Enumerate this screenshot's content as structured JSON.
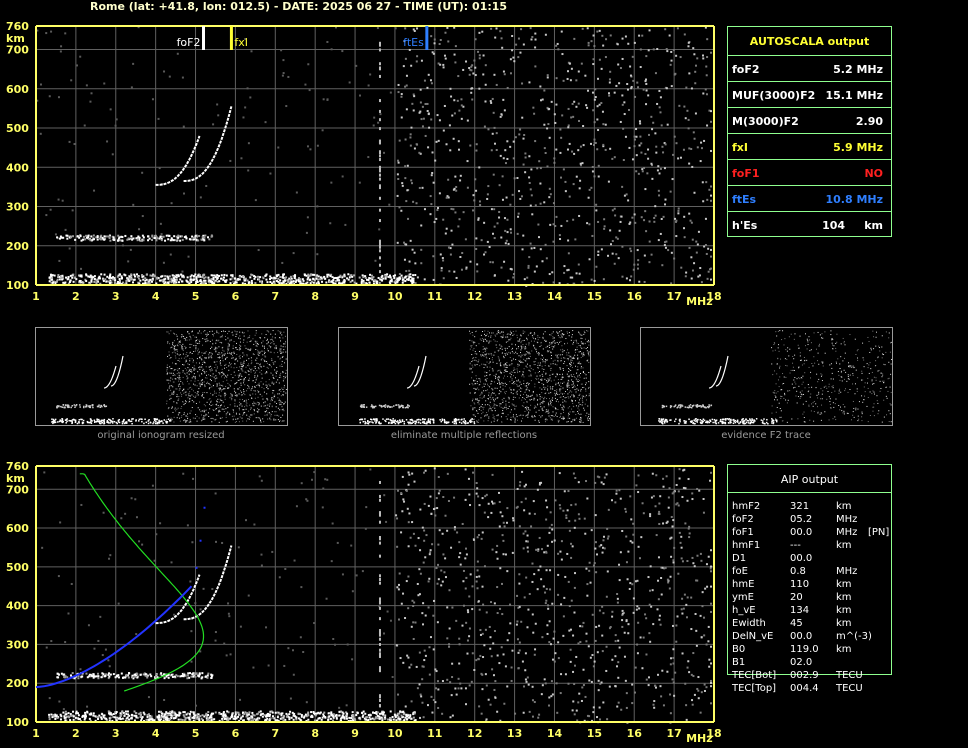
{
  "header": {
    "title": "Rome (lat: +41.8, lon: 012.5) - DATE: 2025 06 27 - TIME (UT): 01:15"
  },
  "top_chart": {
    "y_unit": "km",
    "x_unit": "MHz",
    "y_ticks": [
      "760",
      "700",
      "600",
      "500",
      "400",
      "300",
      "200",
      "100"
    ],
    "x_ticks": [
      "1",
      "2",
      "3",
      "4",
      "5",
      "6",
      "7",
      "8",
      "9",
      "10",
      "11",
      "12",
      "13",
      "14",
      "15",
      "16",
      "17",
      "18"
    ],
    "markers": [
      {
        "label": "foF2",
        "mhz": 5.2,
        "color": "#ffffff"
      },
      {
        "label": "fxI",
        "mhz": 5.9,
        "color": "#ffff33"
      },
      {
        "label": "ftEs",
        "mhz": 10.8,
        "color": "#2f7fff"
      }
    ]
  },
  "autoscala": {
    "title": "AUTOSCALA output",
    "rows": [
      {
        "label": "foF2",
        "value": "5.2 MHz",
        "color": "#ffffff"
      },
      {
        "label": "MUF(3000)F2",
        "value": "15.1 MHz",
        "color": "#ffffff"
      },
      {
        "label": "M(3000)F2",
        "value": "2.90",
        "color": "#ffffff"
      },
      {
        "label": "fxI",
        "value": "5.9 MHz",
        "color": "#ffff33"
      },
      {
        "label": "foF1",
        "value": "NO",
        "color": "#ff2020"
      },
      {
        "label": "ftEs",
        "value": "10.8 MHz",
        "color": "#2f7fff"
      },
      {
        "label": "h'Es",
        "value": "104     km",
        "color": "#ffffff"
      }
    ]
  },
  "thumbnails": [
    {
      "caption": "original ionogram resized"
    },
    {
      "caption": "eliminate multiple reflections"
    },
    {
      "caption": "evidence F2 trace"
    }
  ],
  "bottom_chart": {
    "y_unit": "km",
    "x_unit": "MHz",
    "y_ticks": [
      "760",
      "700",
      "600",
      "500",
      "400",
      "300",
      "200",
      "100"
    ],
    "x_ticks": [
      "1",
      "2",
      "3",
      "4",
      "5",
      "6",
      "7",
      "8",
      "9",
      "10",
      "11",
      "12",
      "13",
      "14",
      "15",
      "16",
      "17",
      "18"
    ]
  },
  "aip": {
    "title": "AIP output",
    "rows": [
      {
        "param": "hmF2",
        "value": "321",
        "unit": "km",
        "extra": ""
      },
      {
        "param": "foF2",
        "value": "05.2",
        "unit": "MHz",
        "extra": ""
      },
      {
        "param": "foF1",
        "value": "00.0",
        "unit": "MHz",
        "extra": "[PN]"
      },
      {
        "param": "hmF1",
        "value": "---",
        "unit": "km",
        "extra": ""
      },
      {
        "param": "D1",
        "value": "00.0",
        "unit": "",
        "extra": ""
      },
      {
        "param": "foE",
        "value": "0.8",
        "unit": "MHz",
        "extra": ""
      },
      {
        "param": "hmE",
        "value": "110",
        "unit": "km",
        "extra": ""
      },
      {
        "param": "ymE",
        "value": "20",
        "unit": "km",
        "extra": ""
      },
      {
        "param": "h_vE",
        "value": "134",
        "unit": "km",
        "extra": ""
      },
      {
        "param": "Ewidth",
        "value": "45",
        "unit": "km",
        "extra": ""
      },
      {
        "param": "DelN_vE",
        "value": "00.0",
        "unit": "m^(-3)",
        "extra": ""
      },
      {
        "param": "B0",
        "value": "119.0",
        "unit": "km",
        "extra": ""
      },
      {
        "param": "B1",
        "value": "02.0",
        "unit": "",
        "extra": ""
      },
      {
        "param": "TEC[Bot]",
        "value": "002.9",
        "unit": "TECU",
        "extra": ""
      },
      {
        "param": "TEC[Top]",
        "value": "004.4",
        "unit": "TECU",
        "extra": ""
      }
    ]
  },
  "colors": {
    "axis": "#ffff66",
    "grid": "#606060",
    "panel_border": "#8fff8f",
    "profile_green": "#22dd22",
    "profile_blue": "#2233ff"
  }
}
